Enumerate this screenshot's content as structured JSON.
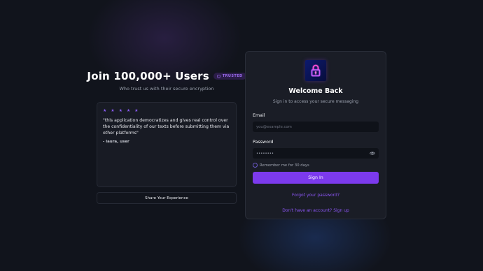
{
  "promo": {
    "headline": "Join 100,000+ Users",
    "badge": "TRUSTED",
    "subline": "Who trust us with their secure encryption"
  },
  "testimonial": {
    "stars": "★ ★ ★ ★ ★",
    "quote": "\"this application democratizes and gives real control over the confidentiality of our texts before submitting them via other platforms\"",
    "author": "- laura, user"
  },
  "share_button": "Share Your Experience",
  "login": {
    "title": "Welcome Back",
    "subtitle": "Sign in to access your secure messaging",
    "email_label": "Email",
    "email_placeholder": "you@example.com",
    "password_label": "Password",
    "password_value": "••••••••",
    "remember_label": "Remember me for 30 days",
    "signin_button": "Sign In",
    "forgot_link": "Forgot your password?",
    "signup_link": "Don't have an account? Sign up"
  },
  "icons": {
    "logo": "lock-icon",
    "badge": "shield-icon",
    "password_toggle": "eye-icon"
  },
  "colors": {
    "accent": "#7c3aed",
    "link": "#8b55f3",
    "background": "#11141c",
    "card": "#1a1d26"
  }
}
